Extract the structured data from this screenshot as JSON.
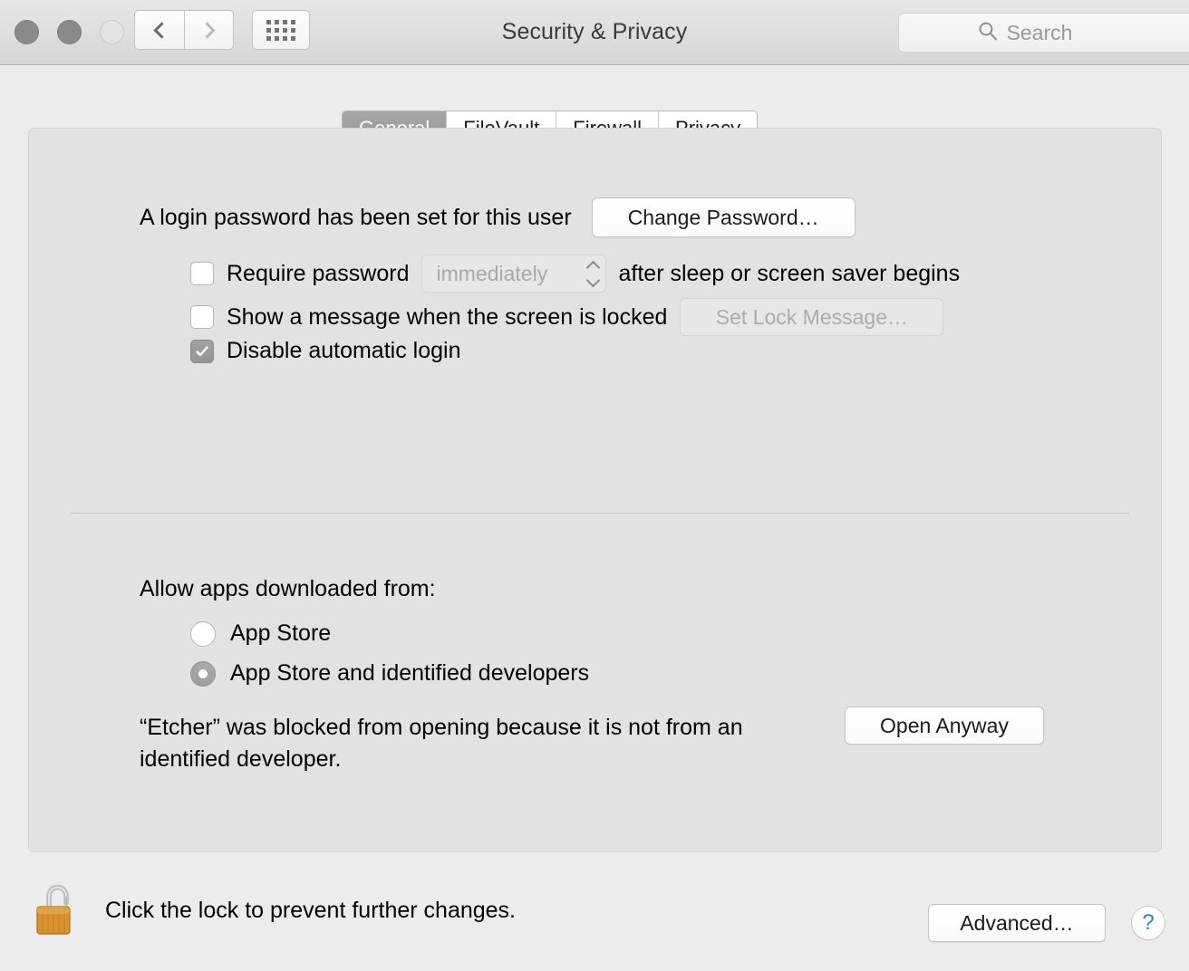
{
  "window": {
    "title": "Security & Privacy",
    "traffic_lights": [
      "close",
      "minimize",
      "zoom"
    ],
    "nav": {
      "back_icon": "chevron-left-icon",
      "forward_icon": "chevron-right-icon"
    },
    "show_all_icon": "grid-apps-icon"
  },
  "search": {
    "icon": "search-icon",
    "placeholder": "Search",
    "value": ""
  },
  "tabs": [
    {
      "label": "General",
      "active": true
    },
    {
      "label": "FileVault",
      "active": false
    },
    {
      "label": "Firewall",
      "active": false
    },
    {
      "label": "Privacy",
      "active": false
    }
  ],
  "general": {
    "password_status": "A login password has been set for this user",
    "change_password_button": "Change Password…",
    "require_password": {
      "label": "Require password",
      "checked": false,
      "delay_value": "immediately",
      "delay_enabled": false,
      "suffix": "after sleep or screen saver begins"
    },
    "show_message": {
      "label": "Show a message when the screen is locked",
      "checked": false,
      "button": "Set Lock Message…",
      "button_enabled": false
    },
    "disable_auto_login": {
      "label": "Disable automatic login",
      "checked": true
    },
    "allow_apps": {
      "title": "Allow apps downloaded from:",
      "options": [
        {
          "label": "App Store",
          "selected": false
        },
        {
          "label": "App Store and identified developers",
          "selected": true
        }
      ]
    },
    "blocked_notice": "“Etcher” was blocked from opening because it is not from an identified developer.",
    "open_anyway_button": "Open Anyway"
  },
  "footer": {
    "lock_icon": "unlocked-padlock-icon",
    "lock_text": "Click the lock to prevent further changes.",
    "advanced_button": "Advanced…",
    "help_button": "?"
  },
  "colors": {
    "window_bg": "#ececec",
    "panel_bg": "#e2e2e2",
    "accent_blue": "#2d7ef7",
    "active_tab_bg": "#949494",
    "lock_gold": "#d9922e"
  }
}
